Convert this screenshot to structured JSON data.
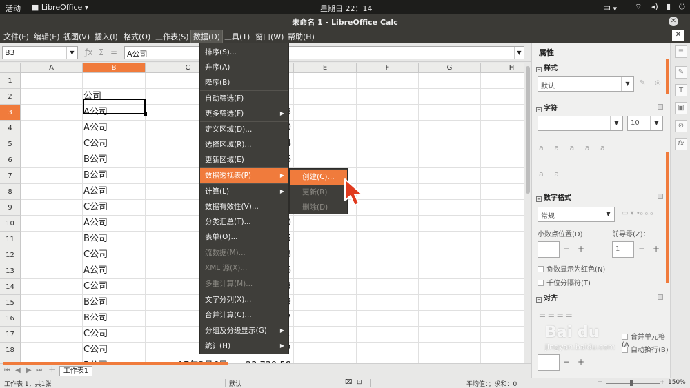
{
  "system": {
    "activities": "活动",
    "app": "LibreOffice",
    "app_arrow": "▾",
    "clock": "星期日 22：14",
    "ime": "中",
    "ime_arrow": "▾"
  },
  "window": {
    "title": "未命名 1 - LibreOffice Calc"
  },
  "menubar": [
    "文件(F)",
    "编辑(E)",
    "视图(V)",
    "插入(I)",
    "格式(O)",
    "工作表(S)",
    "数据(D)",
    "工具(T)",
    "窗口(W)",
    "帮助(H)"
  ],
  "formula_bar": {
    "name_box": "B3",
    "content": "A公司"
  },
  "columns": [
    "A",
    "B",
    "C",
    "D",
    "E",
    "F",
    "G",
    "H"
  ],
  "rows": [
    "1",
    "2",
    "3",
    "4",
    "5",
    "6",
    "7",
    "8",
    "9",
    "10",
    "11",
    "12",
    "13",
    "14",
    "15",
    "16",
    "17",
    "18",
    "19"
  ],
  "cells": {
    "b": [
      "",
      "公司",
      "A公司",
      "A公司",
      "C公司",
      "B公司",
      "B公司",
      "A公司",
      "C公司",
      "A公司",
      "B公司",
      "C公司",
      "A公司",
      "C公司",
      "B公司",
      "B公司",
      "C公司",
      "C公司",
      "B公司"
    ],
    "c": [
      "",
      "日期",
      "17年",
      "17年",
      "17年",
      "17年",
      "17年",
      "17年",
      "17年",
      "17年",
      "17",
      "17年",
      "17年",
      "17",
      "17年",
      "17年",
      "17年",
      "17年",
      "17年3月6日"
    ],
    "d": [
      "",
      "",
      "8",
      "0",
      "4",
      "6",
      "1",
      "8",
      "7",
      "0",
      "5",
      "8",
      "6",
      "3",
      "9",
      "7",
      "1",
      "7",
      "23,739.58"
    ]
  },
  "data_menu": [
    {
      "label": "排序(S)...",
      "enabled": true
    },
    {
      "label": "升序(A)",
      "enabled": true
    },
    {
      "label": "降序(B)",
      "enabled": true
    },
    {
      "label": "自动筛选(F)",
      "enabled": true
    },
    {
      "label": "更多筛选(F)",
      "enabled": true,
      "submenu": true
    },
    {
      "label": "定义区域(D)...",
      "enabled": true
    },
    {
      "label": "选择区域(R)...",
      "enabled": true
    },
    {
      "label": "更新区域(E)",
      "enabled": true
    },
    {
      "label": "数据透视表(P)",
      "enabled": true,
      "submenu": true,
      "highlighted": true
    },
    {
      "label": "计算(L)",
      "enabled": true,
      "submenu": true
    },
    {
      "label": "数据有效性(V)...",
      "enabled": true
    },
    {
      "label": "分类汇总(T)...",
      "enabled": true
    },
    {
      "label": "表单(O)...",
      "enabled": true
    },
    {
      "label": "流数据(M)...",
      "enabled": false
    },
    {
      "label": "XML 源(X)...",
      "enabled": false
    },
    {
      "label": "多重计算(M)...",
      "enabled": false
    },
    {
      "label": "文字分列(X)...",
      "enabled": true
    },
    {
      "label": "合并计算(C)...",
      "enabled": true
    },
    {
      "label": "分组及分级显示(G)",
      "enabled": true,
      "submenu": true
    },
    {
      "label": "统计(H)",
      "enabled": true,
      "submenu": true
    }
  ],
  "pivot_submenu": [
    {
      "label": "创建(C)...",
      "enabled": true,
      "highlighted": true
    },
    {
      "label": "更新(R)",
      "enabled": false
    },
    {
      "label": "删除(D)",
      "enabled": false
    }
  ],
  "sidebar": {
    "title": "属性",
    "styles_section": "样式",
    "style_value": "默认",
    "char_section": "字符",
    "font_size": "10",
    "number_section": "数字格式",
    "number_format": "常规",
    "decimal_label": "小数点位置(D)",
    "leading_zero_label": "前导零(Z)：",
    "leading_zero_value": "1",
    "neg_red": "负数显示为红色(N)",
    "thousand_sep": "千位分隔符(T)",
    "align_section": "对齐",
    "merge_partial": "合并单元格(A",
    "wrap_partial": "自动换行(B)"
  },
  "sheet_tab": "工作表1",
  "status": {
    "sheet_info": "工作表 1，共1张",
    "page_style": "默认",
    "sum_info": "平均值：；求和：0",
    "zoom": "150%"
  },
  "watermark": {
    "main": "Bai du",
    "sub": "jingyan.baidu.com"
  },
  "colors": {
    "accent": "#f07b3c",
    "menu_bg": "#3f3e3a",
    "topbar": "#1d1d1b",
    "titlebar": "#3b3a36"
  }
}
